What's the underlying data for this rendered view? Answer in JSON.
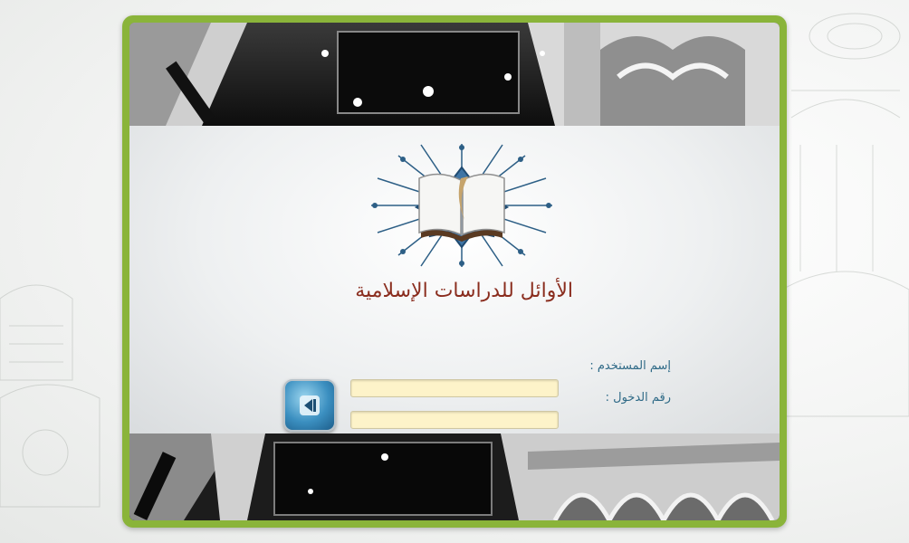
{
  "header": {
    "title": "الأوائل للدراسات الإسلامية"
  },
  "form": {
    "username_label": "إسم المستخدم :",
    "username_value": "",
    "password_label": "رقم الدخول :",
    "password_value": ""
  },
  "icons": {
    "login": "arrow-left-icon",
    "logo": "quran-book-icon"
  },
  "colors": {
    "frame": "#8ab43a",
    "title": "#8a2d1e",
    "labels": "#2f6a87",
    "input_bg": "#fdf3c9",
    "button": "#3b8fc0"
  }
}
